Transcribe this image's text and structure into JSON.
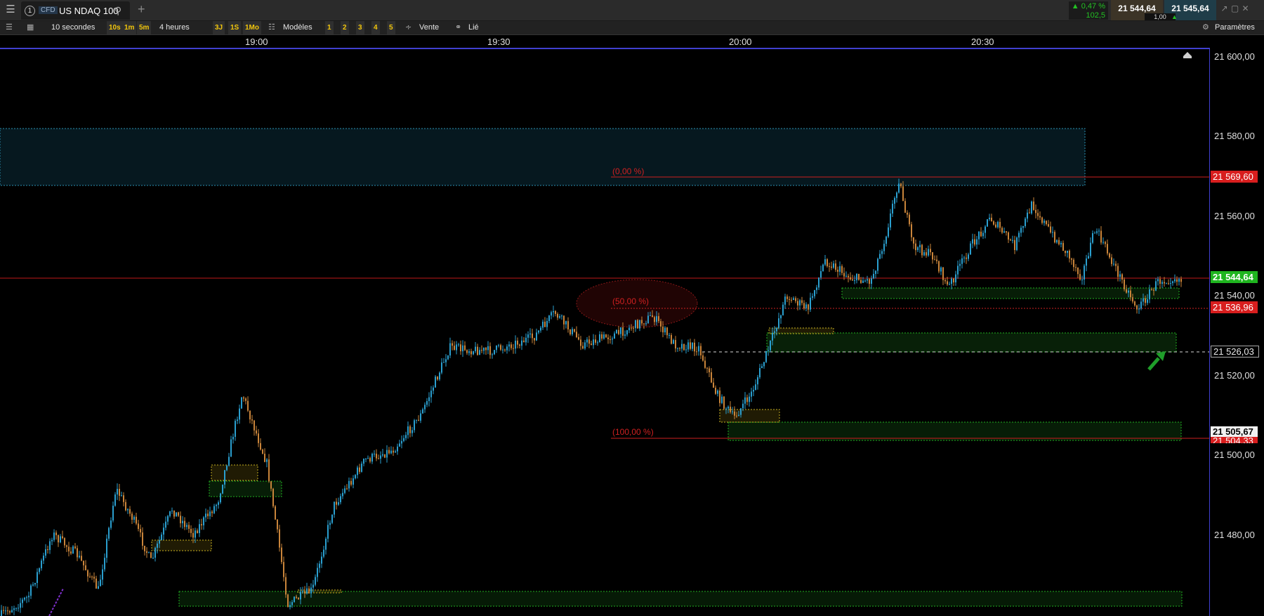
{
  "topbar": {
    "tab_number": "1",
    "instrument_type": "CFD",
    "instrument_name": "US NDAQ 100",
    "change_pct": "▲ 0,47 %",
    "change_pts": "102,5",
    "sell_price": "21 544,64",
    "buy_price": "21 545,64",
    "spread": "1,00",
    "icons": [
      "menu-icon",
      "search-icon",
      "add-tab-icon",
      "window-restore-icon",
      "window-maximize-icon",
      "close-icon"
    ]
  },
  "toolbar": {
    "interval": "10 secondes",
    "quick_intervals": [
      "10s",
      "1m",
      "5m"
    ],
    "range": "4 heures",
    "quick_ranges": [
      "3J",
      "1S",
      "1Mo"
    ],
    "templates": "Modèles",
    "layouts": [
      "1",
      "2",
      "3",
      "4",
      "5"
    ],
    "side": "Vente",
    "link": "Lié",
    "settings": "Paramètres"
  },
  "time_axis": {
    "labels": [
      "19:00",
      "19:30",
      "20:00",
      "20:30"
    ]
  },
  "price_axis": {
    "labels": [
      "21 600,00",
      "21 580,00",
      "21 560,00",
      "21 540,00",
      "21 520,00",
      "21 500,00",
      "21 480,00"
    ],
    "tag_high": "21 569,60",
    "tag_current": "21 544,64",
    "tag_fib50": "21 536,96",
    "tag_crosshair": "21 526,03",
    "tag_low": "21 505,67",
    "tag_hidden": "21 504,33"
  },
  "fibonacci": {
    "level_0": "(0,00 %)",
    "level_50": "(50,00 %)",
    "level_100": "(100,00 %)"
  },
  "colors": {
    "bull": "#2a9fcf",
    "bear": "#c9843a",
    "fib_line": "#cc1f1f",
    "current_tag": "#1fb51f",
    "zone_green": "#20b020",
    "zone_yellow": "#c8b020",
    "zone_cyan": "#2a8fb0"
  }
}
